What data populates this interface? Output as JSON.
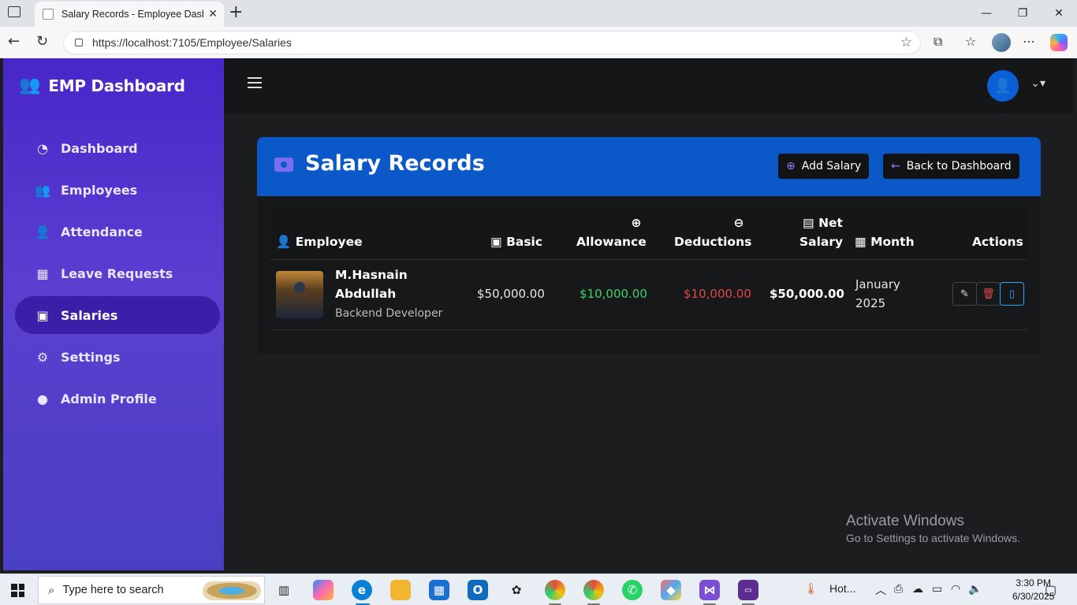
{
  "browser": {
    "tab_title": "Salary Records - Employee Dashb",
    "url": "https://localhost:7105/Employee/Salaries"
  },
  "sidebar": {
    "brand": "EMP Dashboard",
    "items": [
      {
        "label": "Dashboard",
        "icon": "gauge-icon"
      },
      {
        "label": "Employees",
        "icon": "users-icon"
      },
      {
        "label": "Attendance",
        "icon": "user-check-icon"
      },
      {
        "label": "Leave Requests",
        "icon": "calendar-check-icon"
      },
      {
        "label": "Salaries",
        "icon": "money-bill-icon",
        "active": true
      },
      {
        "label": "Settings",
        "icon": "gear-icon"
      },
      {
        "label": "Admin Profile",
        "icon": "user-circle-icon"
      }
    ]
  },
  "page": {
    "title": "Salary Records",
    "add_button": "Add Salary",
    "back_button": "Back to Dashboard"
  },
  "table": {
    "headers": {
      "employee": "Employee",
      "basic": "Basic",
      "allowance": "Allowance",
      "deductions": "Deductions",
      "net_1": "Net",
      "net_2": "Salary",
      "month": "Month",
      "actions": "Actions"
    },
    "rows": [
      {
        "name_1": "M.Hasnain",
        "name_2": "Abdullah",
        "role": "Backend Developer",
        "basic": "$50,000.00",
        "allowance": "$10,000.00",
        "deductions": "$10,000.00",
        "net": "$50,000.00",
        "month_1": "January",
        "month_2": "2025"
      }
    ]
  },
  "colors": {
    "allowance": "#3fd16b",
    "deductions": "#e0474c",
    "accent": "#0b58c9"
  },
  "watermark": {
    "line1": "Activate Windows",
    "line2": "Go to Settings to activate Windows."
  },
  "taskbar": {
    "search_placeholder": "Type here to search",
    "weather": "Hot...",
    "time": "3:30 PM",
    "date": "6/30/2025"
  }
}
